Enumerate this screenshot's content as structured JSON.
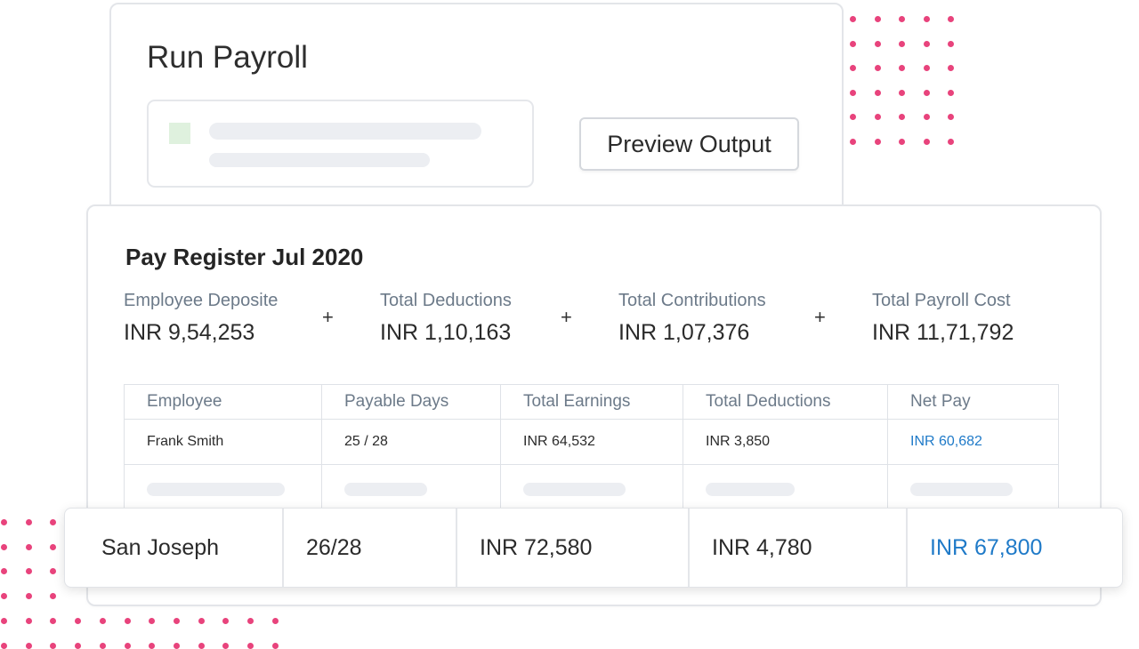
{
  "payroll": {
    "title": "Run Payroll",
    "preview_button": "Preview Output"
  },
  "register": {
    "title": "Pay Register Jul 2020",
    "summary": [
      {
        "label": "Employee Deposite",
        "value": "INR 9,54,253"
      },
      {
        "label": "Total Deductions",
        "value": "INR 1,10,163"
      },
      {
        "label": "Total Contributions",
        "value": "INR 1,07,376"
      },
      {
        "label": "Total Payroll Cost",
        "value": "INR 11,71,792"
      }
    ],
    "operator": "+",
    "table": {
      "columns": [
        "Employee",
        "Payable Days",
        "Total Earnings",
        "Total Deductions",
        "Net Pay"
      ],
      "rows": [
        [
          "Frank Smith",
          "25 / 28",
          "INR 64,532",
          "INR 3,850",
          "INR 60,682"
        ]
      ]
    }
  },
  "highlight_row": [
    "San Joseph",
    "26/28",
    "INR 72,580",
    "INR 4,780",
    "INR 67,800"
  ],
  "colors": {
    "accent_dots": "#e8437c",
    "net_pay_link": "#1f7ac8",
    "placeholder": "#eceef2",
    "placeholder_green": "#dff1de"
  }
}
